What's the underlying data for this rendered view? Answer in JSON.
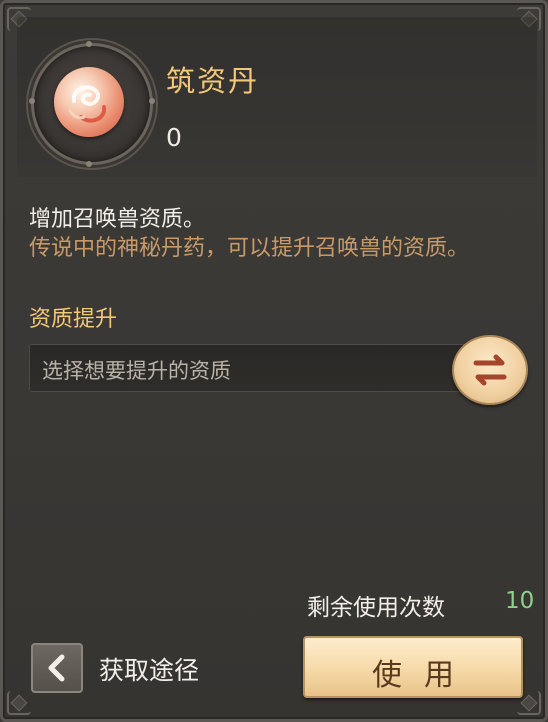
{
  "item": {
    "name": "筑资丹",
    "count": "0",
    "icon": "spiral-pill-icon"
  },
  "description": {
    "main": "增加召唤兽资质。",
    "flavor": "传说中的神秘丹药，可以提升召唤兽的资质。"
  },
  "upgrade": {
    "section_title": "资质提升",
    "select_placeholder": "选择想要提升的资质",
    "swap_icon": "swap-arrows-icon"
  },
  "remaining": {
    "label": "剩余使用次数",
    "count": "10"
  },
  "footer": {
    "back_icon": "chevron-left-icon",
    "acquire_label": "获取途径",
    "use_label": "使用"
  },
  "colors": {
    "title_gold": "#f2c877",
    "flavor_brown": "#c99a68",
    "count_green": "#8ed08a",
    "button_cream": "#f6d9a7"
  }
}
